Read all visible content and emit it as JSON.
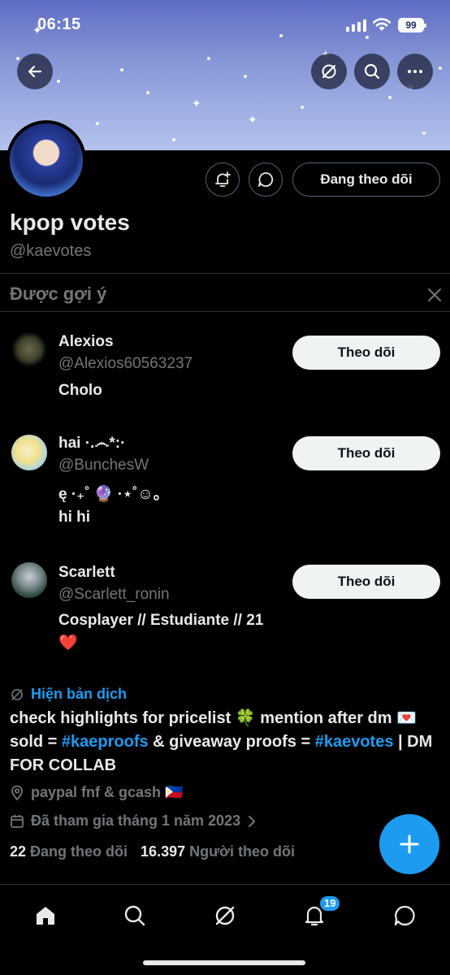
{
  "status_bar": {
    "time": "06:15",
    "battery": "99"
  },
  "profile": {
    "name": "kpop votes",
    "handle": "@kaevotes",
    "follow_state": "Đang theo dõi"
  },
  "suggestions": {
    "title": "Được gợi ý",
    "items": [
      {
        "name": "Alexios",
        "handle": "@Alexios60563237",
        "bio": "Cholo",
        "button": "Theo dõi"
      },
      {
        "name": "hai ·.෴*:·",
        "handle": "@BunchesW",
        "bio": "ę ·₊˚ 🔮 ·⋆˚☺。\nhi hi",
        "button": "Theo dõi"
      },
      {
        "name": "Scarlett",
        "handle": "@Scarlett_ronin",
        "bio": "Cosplayer // Estudiante // 21\n❤️",
        "button": "Theo dõi"
      }
    ]
  },
  "translate_label": "Hiện bản dịch",
  "bio": {
    "part1": "check highlights for pricelist 🍀 mention after dm 💌 sold = ",
    "link1": "#kaeproofs",
    "part2": " & giveaway proofs = ",
    "link2": "#kaevotes",
    "part3": " | DM FOR COLLAB"
  },
  "location": "paypal fnf & gcash 🇵🇭",
  "joined": "Đã tham gia tháng 1 năm 2023",
  "counts": {
    "following_num": "22",
    "following_label": "Đang theo dõi",
    "followers_num": "16.397",
    "followers_label": "Người theo dõi"
  },
  "tabbar": {
    "notifications_badge": "19"
  },
  "icons": [
    "back-icon",
    "grok-icon",
    "search-icon",
    "more-icon",
    "notify-add-icon",
    "message-icon",
    "close-icon",
    "translate-icon",
    "location-icon",
    "calendar-icon",
    "chevron-right-icon",
    "plus-icon",
    "home-icon",
    "bell-icon",
    "mail-icon"
  ],
  "colors": {
    "accent": "#1d9bf0",
    "background": "#000000",
    "secondary_text": "#71767b",
    "primary_text": "#e7e9ea"
  }
}
